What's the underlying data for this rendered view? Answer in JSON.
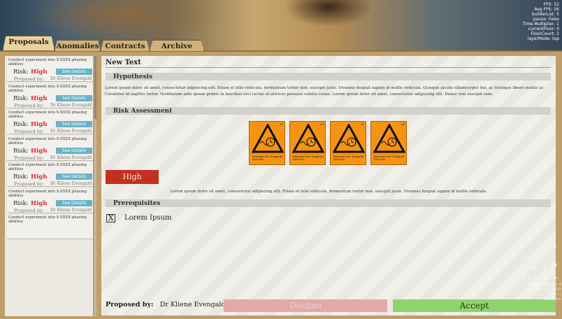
{
  "debug": [
    "FPS: 52",
    "Avg FPS: 56",
    "builderList: 5",
    "pause: False",
    "Time Multiplier: 1",
    "currentFloor: 0",
    "FloorCount: 2",
    "layerMode: top"
  ],
  "tabs": [
    {
      "label": "Proposals",
      "active": true
    },
    {
      "label": "Anomalies",
      "active": false
    },
    {
      "label": "Contracts",
      "active": false
    },
    {
      "label": "Archive",
      "active": false
    }
  ],
  "proposals": [
    {
      "title": "Conduct experiment into S-XXXX phasing abilities",
      "risk_label": "Risk:",
      "risk": "High",
      "details": "See Details",
      "proposed_label": "Proposed by:",
      "proposer": "Dr Kliene Evengald"
    },
    {
      "title": "Conduct experiment into S-XXXX phasing abilities",
      "risk_label": "Risk:",
      "risk": "High",
      "details": "See Details",
      "proposed_label": "Proposed by:",
      "proposer": "Dr Kliene Evengald"
    },
    {
      "title": "Conduct experiment into S-XXXX phasing abilities",
      "risk_label": "Risk:",
      "risk": "High",
      "details": "See Details",
      "proposed_label": "Proposed by:",
      "proposer": "Dr Kliene Evengald"
    },
    {
      "title": "Conduct experiment into S-XXXX phasing abilities",
      "risk_label": "Risk:",
      "risk": "High",
      "details": "See Details",
      "proposed_label": "Proposed by:",
      "proposer": "Dr Kliene Evengald"
    },
    {
      "title": "Conduct experiment into S-XXXX phasing abilities",
      "risk_label": "Risk:",
      "risk": "High",
      "details": "See Details",
      "proposed_label": "Proposed by:",
      "proposer": "Dr Kliene Evengald"
    },
    {
      "title": "Conduct experiment into S-XXXX phasing abilities",
      "risk_label": "Risk:",
      "risk": "High",
      "details": "See Details",
      "proposed_label": "Proposed by:",
      "proposer": "Dr Kliene Evengald"
    },
    {
      "title": "Conduct experiment into S-XXXX phasing abilities",
      "risk_label": "",
      "risk": "",
      "details": "",
      "proposed_label": "",
      "proposer": ""
    }
  ],
  "detail": {
    "title": "New Text",
    "hypothesis_heading": "Hypothesis",
    "hypothesis_text": "Lorem ipsum dolor sit amet, consectetur adipiscing elit. Etiam et felis vehicula, fermentum tortor non, suscipit justo. Vivamus feugiat sapien id mollis vehicula. Quisque iaculis ullamcorper dui, ac tristique libero mattis ac. Curabitur id sagittis tortor. Vestibulum ante ipsum primis in faucibus orci luctus et ultrices posuere cubilia curae; Lorem ipsum dolor sit amet, consectetur adipiscing elit. Donec non suscipit sem.",
    "risk_heading": "Risk Assessment",
    "hazard_cards": [
      {
        "number": "IV",
        "caption": "Retrospective Temporal Particles",
        "icon": "temporal-hazard-icon"
      },
      {
        "number": "IV",
        "caption": "Retrospective Temporal Particles",
        "icon": "temporal-hazard-icon"
      },
      {
        "number": "IV",
        "caption": "Retrospective Temporal Particles",
        "icon": "temporal-hazard-icon"
      },
      {
        "number": "IV",
        "caption": "Retrospective Temporal Particles",
        "icon": "temporal-hazard-icon"
      }
    ],
    "risk_level": "High",
    "risk_text": "Lorem ipsum dolor sit amet, consectetur adipiscing elit. Etiam et felis vehicula, fermentum tortor non, suscipit justo. Vivamus feugiat sapien id mollis vehicula.",
    "prereq_heading": "Prerequisites",
    "prerequisites": [
      {
        "checked": true,
        "mark": "X",
        "label": "Lorem Ipsum"
      }
    ],
    "proposed_by_label": "Proposed by:",
    "proposer": "Dr Kliene Evengald",
    "decline_label": "Decline",
    "accept_label": "Accept"
  },
  "game_info": {
    "line1": "4 - Happy Thought 4",
    "line2": "January 21st 2020",
    "line3": "Year 1",
    "line4": "15:00 pm"
  },
  "colors": {
    "risk_high": "#e0263a",
    "decline": "#e3a8a8",
    "accept": "#8ed46c",
    "details_button": "#69b3c7",
    "hazard_card": "#f59413",
    "risk_badge": "#c43020"
  }
}
